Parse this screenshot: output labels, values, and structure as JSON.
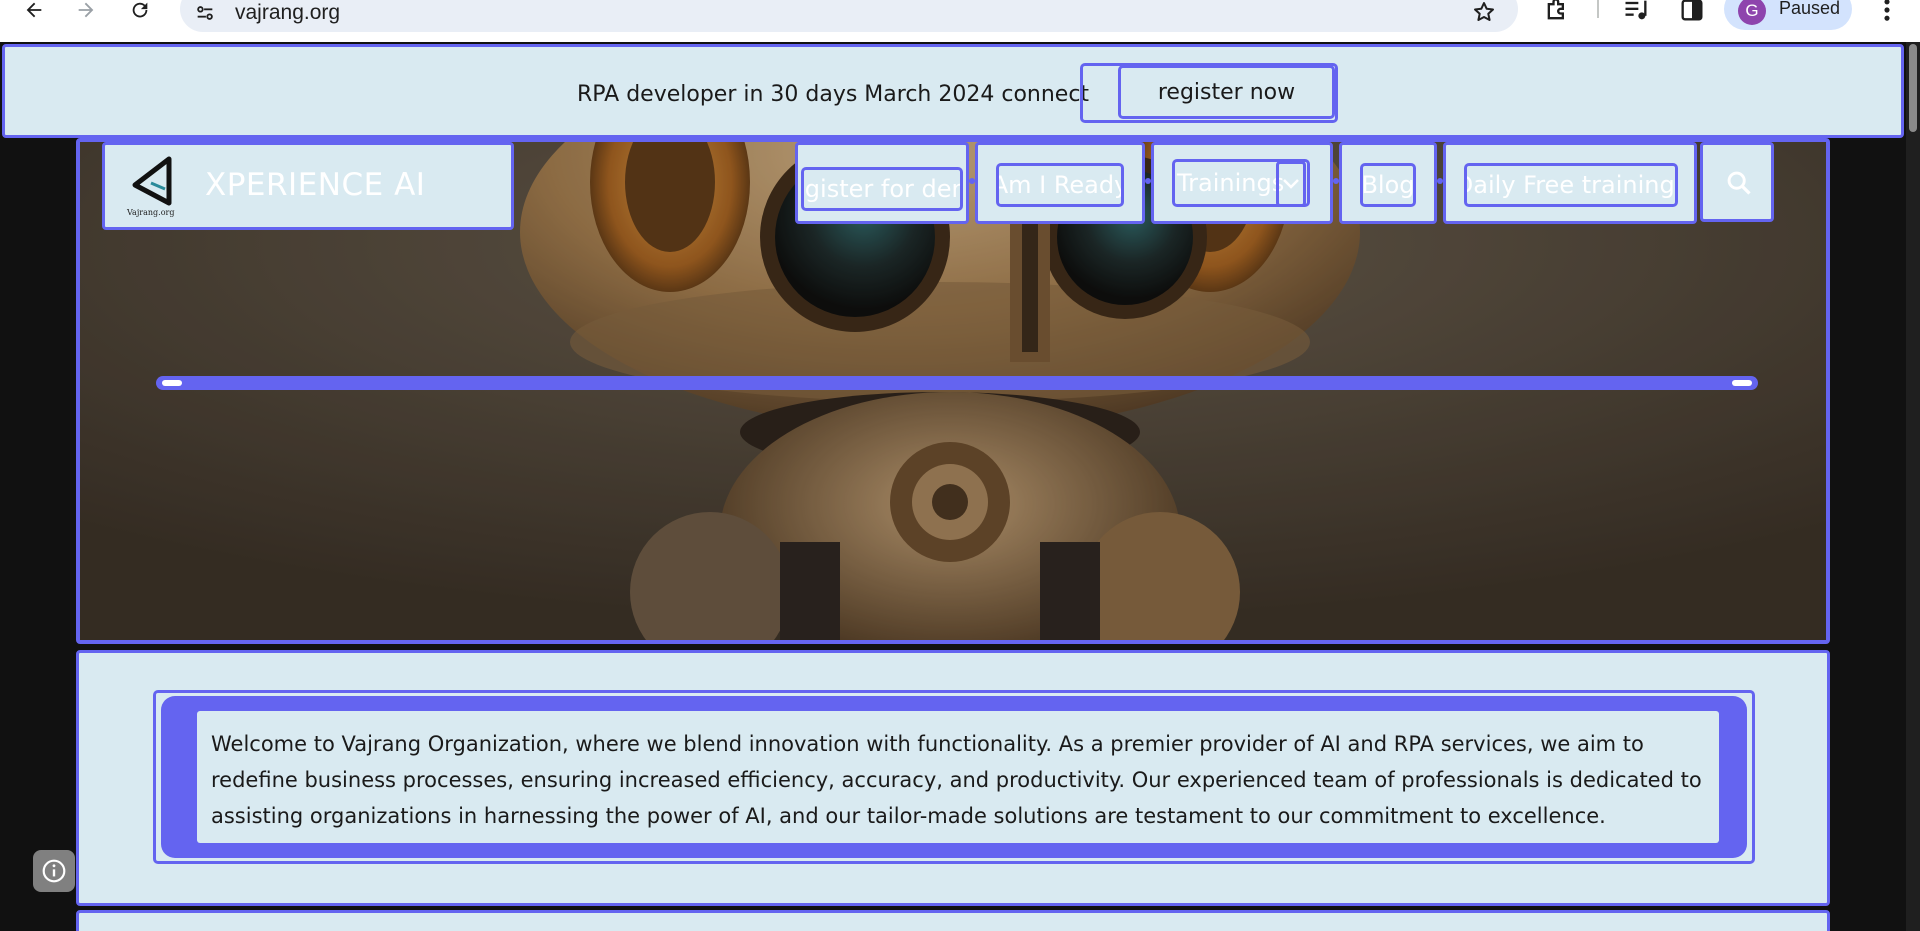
{
  "browser": {
    "url": "vajrang.org",
    "profile_initial": "G",
    "profile_status": "Paused"
  },
  "announcement": {
    "message": "RPA developer in 30 days March 2024 connect",
    "button_label": "register now"
  },
  "header": {
    "logo_caption": "Vajrang.org",
    "site_title": "XPERIENCE AI",
    "menu": [
      {
        "label": "Register for demo"
      },
      {
        "label": "Am I Ready"
      },
      {
        "label": "Trainings"
      },
      {
        "label": "Blog"
      },
      {
        "label": "Daily Free trainings"
      }
    ]
  },
  "welcome": {
    "text": "Welcome to Vajrang Organization, where we blend innovation with functionality. As a premier provider of AI and RPA services, we aim to redefine business processes, ensuring increased efficiency, accuracy, and productivity. Our experienced team of professionals is dedicated to assisting organizations in harnessing the power of AI, and our tailor-made solutions are testament to our commitment to excellence."
  },
  "colors": {
    "accent": "#6464f0",
    "panel": "#d9eaf1"
  }
}
